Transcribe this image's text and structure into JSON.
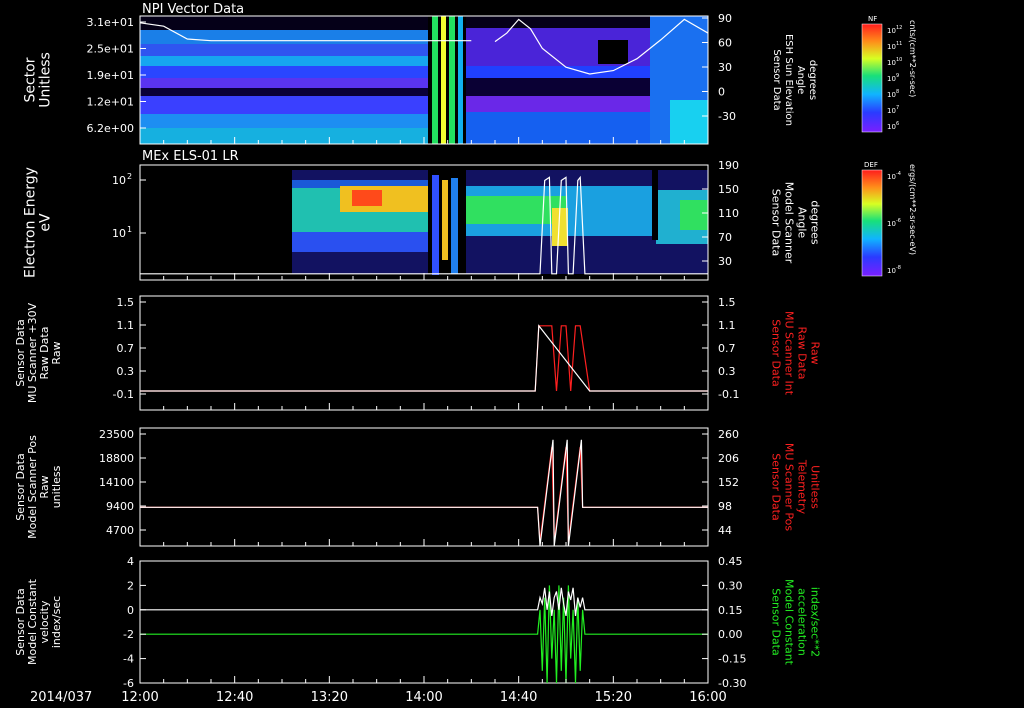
{
  "date_label": "2014/037",
  "time_axis": {
    "start_label": "12:00",
    "end_label": "16:00",
    "ticks": [
      "12:00",
      "12:40",
      "13:20",
      "14:00",
      "14:40",
      "15:20",
      "16:00"
    ],
    "range_minutes": [
      0,
      240
    ]
  },
  "colors": {
    "white": "#ffffff",
    "red": "#ff2020",
    "green": "#22ee22",
    "background": "#000000"
  },
  "panels": [
    {
      "id": "npi",
      "title": "NPI Vector Data",
      "left_label": [
        "Sector",
        "Unitless"
      ],
      "left_ticks": [
        "3.1e+01",
        "2.5e+01",
        "1.9e+01",
        "1.2e+01",
        "6.2e+00"
      ],
      "right_label": [
        "Sensor Data",
        "ESH Sun Elevation",
        "Angle",
        "degrees"
      ],
      "right_ticks": [
        "90",
        "60",
        "30",
        "0",
        "-30"
      ]
    },
    {
      "id": "els",
      "title": "MEx ELS-01 LR",
      "left_label": [
        "Electron Energy",
        "eV"
      ],
      "left_ticks": [
        "10",
        "10"
      ],
      "left_tick_exponents": [
        "2",
        "1"
      ],
      "right_label": [
        "Sensor Data",
        "Model Scanner",
        "Angle",
        "degrees"
      ],
      "right_ticks": [
        "190",
        "150",
        "110",
        "70",
        "30"
      ]
    },
    {
      "id": "mu_int",
      "title": "",
      "left_label": [
        "Sensor Data",
        "MU Scanner +30V",
        "Raw Data",
        "Raw"
      ],
      "left_ticks": [
        "1.5",
        "1.1",
        "0.7",
        "0.3",
        "-0.1"
      ],
      "right_label": [
        "Sensor Data",
        "MU Scanner Int",
        "Raw Data",
        "Raw"
      ],
      "right_ticks": [
        "1.5",
        "1.1",
        "0.7",
        "0.3",
        "-0.1"
      ]
    },
    {
      "id": "scanner_pos",
      "title": "",
      "left_label": [
        "Sensor Data",
        "Model Scanner Pos",
        "Raw",
        "unitless"
      ],
      "left_ticks": [
        "23500",
        "18800",
        "14100",
        "9400",
        "4700"
      ],
      "right_label": [
        "Sensor Data",
        "MU Scanner Pos",
        "Telemetry",
        "Unitless"
      ],
      "right_ticks": [
        "260",
        "206",
        "152",
        "98",
        "44"
      ]
    },
    {
      "id": "model_const",
      "title": "",
      "left_label": [
        "Sensor Data",
        "Model Constant",
        "velocity",
        "index/sec"
      ],
      "left_ticks": [
        "4",
        "2",
        "0",
        "-2",
        "-4",
        "-6"
      ],
      "right_label": [
        "Sensor Data",
        "Model Constant",
        "acceleration",
        "index/sec**2"
      ],
      "right_ticks": [
        "0.45",
        "0.30",
        "0.15",
        "0.00",
        "-0.15",
        "-0.30"
      ]
    }
  ],
  "colorbars": [
    {
      "id": "nf",
      "title": "NF",
      "unit": "cnts/(cm**2-sr-sec)",
      "ticks": [
        "10",
        "10",
        "10",
        "10",
        "10",
        "10",
        "10"
      ],
      "tick_exponents": [
        "12",
        "11",
        "10",
        "9",
        "8",
        "7",
        "6"
      ]
    },
    {
      "id": "def",
      "title": "DEF",
      "unit": "ergs/(cm**2-sr-sec-eV)",
      "ticks": [
        "10",
        "10",
        "10"
      ],
      "tick_exponents": [
        "-4",
        "-6",
        "-8"
      ]
    }
  ],
  "chart_data": [
    {
      "type": "heatmap",
      "panel": "npi",
      "title": "NPI Vector Data",
      "ylabel": "Sector Unitless",
      "y2label": "Sensor Data ESH Sun Elevation Angle degrees",
      "xlim_minutes": [
        0,
        240
      ],
      "y2lim": [
        -60,
        90
      ],
      "line_series": [
        {
          "name": "ESH Sun Elevation Angle",
          "color": "#ffffff",
          "x": [
            0,
            10,
            20,
            30,
            60,
            100,
            140,
            170,
            176,
            180,
            190,
            200,
            215,
            230,
            240
          ],
          "y": [
            82,
            78,
            63,
            61,
            61,
            61,
            61,
            61,
            60,
            60,
            60,
            60,
            60,
            60,
            60
          ],
          "x2": [
            150,
            155,
            160,
            165,
            170,
            180,
            190,
            200,
            210,
            220,
            230,
            240
          ],
          "y2": [
            60,
            70,
            86,
            75,
            52,
            30,
            22,
            26,
            40,
            62,
            86,
            70
          ]
        }
      ]
    },
    {
      "type": "heatmap",
      "panel": "els",
      "title": "MEx ELS-01 LR",
      "ylabel": "Electron Energy eV",
      "y2label": "Sensor Data Model Scanner Angle degrees",
      "xlim_minutes": [
        0,
        240
      ],
      "y2lim": [
        5,
        190
      ],
      "ylog": true,
      "line_series": [
        {
          "name": "Model Scanner Angle",
          "color": "#ffffff",
          "x": [
            0,
            60,
            120,
            168,
            169,
            171,
            173,
            174,
            176,
            178,
            180,
            181,
            183,
            185,
            186,
            188,
            190,
            240
          ],
          "y": [
            15,
            15,
            15,
            15,
            15,
            165,
            170,
            15,
            15,
            165,
            170,
            15,
            15,
            165,
            170,
            15,
            15,
            15
          ]
        }
      ]
    },
    {
      "type": "line",
      "panel": "mu_int",
      "ylabel": "Sensor Data MU Scanner +30V Raw Data Raw",
      "y2label": "Sensor Data MU Scanner Int Raw Data Raw",
      "xlim_minutes": [
        0,
        240
      ],
      "ylim": [
        -0.3,
        1.5
      ],
      "series": [
        {
          "name": "MU Scanner Int Raw Data",
          "color": "#ff2020",
          "x": [
            0,
            167,
            168.5,
            170,
            174,
            176,
            178,
            180,
            182,
            184,
            186,
            190,
            240
          ],
          "y": [
            0,
            0,
            1.03,
            1.03,
            1.03,
            0,
            1.03,
            1.03,
            0,
            1.03,
            1.03,
            0,
            0
          ]
        },
        {
          "name": "MU Scanner +30V Raw Data",
          "color": "#ffffff",
          "x": [
            0,
            167,
            168.5,
            190,
            240
          ],
          "y": [
            0,
            0,
            1.03,
            0,
            0
          ]
        }
      ]
    },
    {
      "type": "line",
      "panel": "scanner_pos",
      "ylabel": "Sensor Data Model Scanner Pos Raw unitless",
      "y2label": "Sensor Data MU Scanner Pos Telemetry Unitless",
      "xlim_minutes": [
        0,
        240
      ],
      "ylim": [
        0,
        25000
      ],
      "series": [
        {
          "name": "MU Scanner Pos Telemetry",
          "color": "#ff2020",
          "x": [
            0,
            168,
            169,
            174,
            175,
            180,
            181,
            186,
            187,
            240
          ],
          "y": [
            8200,
            8200,
            1000,
            21000,
            1000,
            21000,
            1000,
            21000,
            8200,
            8200
          ]
        },
        {
          "name": "Model Scanner Pos",
          "color": "#ffffff",
          "x": [
            0,
            168,
            169,
            174.5,
            175,
            180.5,
            181,
            186.5,
            187,
            240
          ],
          "y": [
            8200,
            8200,
            0,
            22500,
            0,
            22500,
            0,
            22500,
            8200,
            8200
          ]
        }
      ]
    },
    {
      "type": "line",
      "panel": "model_const",
      "ylabel": "Sensor Data Model Constant velocity index/sec",
      "y2label": "Sensor Data Model Constant acceleration index/sec**2",
      "xlim_minutes": [
        0,
        240
      ],
      "ylim": [
        -6,
        4
      ],
      "y2lim": [
        -0.3,
        0.45
      ],
      "series": [
        {
          "name": "Model Constant acceleration",
          "color": "#22ee22",
          "x": [
            0,
            168,
            169,
            170,
            171,
            172,
            173,
            174,
            175,
            176,
            177,
            178,
            179,
            180,
            181,
            182,
            183,
            184,
            185,
            186,
            187,
            188,
            240
          ],
          "y": [
            -2,
            -2,
            0,
            -5,
            1,
            -6,
            2,
            -4,
            0,
            -6,
            2,
            -5,
            1,
            -6,
            2,
            -4,
            0,
            -6,
            1,
            -5,
            0,
            -2,
            -2
          ]
        },
        {
          "name": "Model Constant velocity",
          "color": "#ffffff",
          "x": [
            0,
            168,
            169,
            170,
            171,
            172,
            173,
            174,
            175,
            176,
            177,
            178,
            179,
            180,
            181,
            182,
            183,
            184,
            185,
            186,
            187,
            188,
            240
          ],
          "y": [
            0,
            0,
            1,
            0.5,
            1.8,
            0,
            1.5,
            -0.5,
            1,
            1.5,
            0,
            1.8,
            0.5,
            -0.5,
            1.5,
            0.8,
            1.8,
            -0.5,
            1,
            0.2,
            1,
            0,
            0
          ]
        }
      ]
    }
  ]
}
